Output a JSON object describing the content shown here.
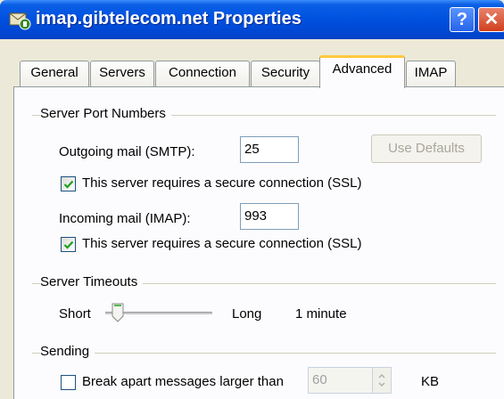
{
  "window": {
    "title": "imap.gibtelecom.net Properties",
    "help_label": "?",
    "close_label": "✕"
  },
  "tabs": [
    {
      "label": "General",
      "active": false
    },
    {
      "label": "Servers",
      "active": false
    },
    {
      "label": "Connection",
      "active": false
    },
    {
      "label": "Security",
      "active": false
    },
    {
      "label": "Advanced",
      "active": true
    },
    {
      "label": "IMAP",
      "active": false
    }
  ],
  "ports": {
    "group_label": "Server Port Numbers",
    "smtp_label": "Outgoing mail (SMTP):",
    "smtp_value": "25",
    "use_defaults_label": "Use Defaults",
    "smtp_ssl_label": "This server requires a secure connection (SSL)",
    "smtp_ssl_checked": true,
    "imap_label": "Incoming mail (IMAP):",
    "imap_value": "993",
    "imap_ssl_label": "This server requires a secure connection (SSL)",
    "imap_ssl_checked": true
  },
  "timeouts": {
    "group_label": "Server Timeouts",
    "short_label": "Short",
    "long_label": "Long",
    "value_label": "1 minute",
    "slider_position": 0
  },
  "sending": {
    "group_label": "Sending",
    "break_apart_label": "Break apart messages larger than",
    "break_apart_checked": false,
    "size_value": "60",
    "unit_label": "KB"
  },
  "colors": {
    "titlebar": "#0052e0",
    "active_tab_accent": "#ffc83c",
    "check_mark": "#21a121"
  }
}
